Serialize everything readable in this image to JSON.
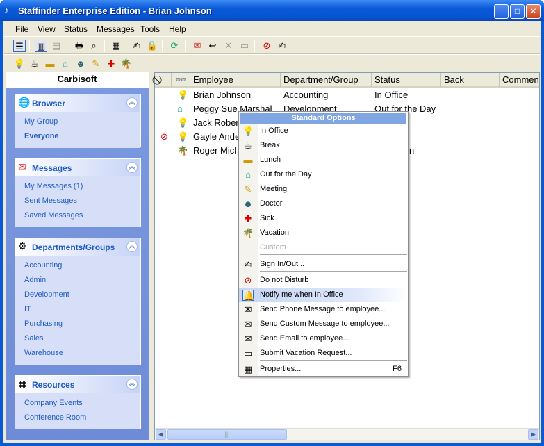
{
  "window": {
    "title": "Staffinder Enterprise Edition - Brian Johnson",
    "minimize": "_",
    "maximize": "□",
    "close": "✕"
  },
  "menu": [
    "File",
    "View",
    "Status",
    "Messages",
    "Tools",
    "Help"
  ],
  "sidebar": {
    "title": "Carbisoft",
    "browser": {
      "title": "Browser",
      "items": [
        "My Group",
        "Everyone"
      ]
    },
    "messages": {
      "title": "Messages",
      "items": [
        "My Messages (1)",
        "Sent Messages",
        "Saved Messages"
      ]
    },
    "departments": {
      "title": "Departments/Groups",
      "items": [
        "Accounting",
        "Admin",
        "Development",
        "IT",
        "Purchasing",
        "Sales",
        "Warehouse"
      ]
    },
    "resources": {
      "title": "Resources",
      "items": [
        "Company Events",
        "Conference Room"
      ]
    }
  },
  "grid": {
    "columns": [
      "⃠",
      "👓",
      "Employee",
      "Department/Group",
      "Status",
      "Back",
      "Commen"
    ],
    "rows": [
      {
        "employee": "Brian Johnson",
        "department": "Accounting",
        "status": "In Office"
      },
      {
        "employee": "Peggy Sue Marshal",
        "department": "Development",
        "status": "Out for the Day"
      },
      {
        "employee": "Jack Rober",
        "department": "",
        "status": ""
      },
      {
        "employee": "Gayle Ande",
        "department": "",
        "status": ""
      },
      {
        "employee": "Roger Mich",
        "department": "",
        "status": "n"
      }
    ]
  },
  "context_menu": {
    "header": "Standard Options",
    "items": [
      {
        "label": "In Office"
      },
      {
        "label": "Break"
      },
      {
        "label": "Lunch"
      },
      {
        "label": "Out for the Day"
      },
      {
        "label": "Meeting"
      },
      {
        "label": "Doctor"
      },
      {
        "label": "Sick"
      },
      {
        "label": "Vacation"
      },
      {
        "label": "Custom"
      },
      {
        "label": "Sign In/Out..."
      },
      {
        "label": "Do not Disturb"
      },
      {
        "label": "Notify me when In Office"
      },
      {
        "label": "Send Phone Message to employee..."
      },
      {
        "label": "Send Custom Message to employee..."
      },
      {
        "label": "Send Email to employee..."
      },
      {
        "label": "Submit Vacation Request..."
      },
      {
        "label": "Properties...",
        "shortcut": "F6"
      }
    ]
  },
  "colors": {
    "titlebar": "#0a5ad8",
    "panel_text": "#215dc6",
    "highlight": "#c5d6f5"
  }
}
